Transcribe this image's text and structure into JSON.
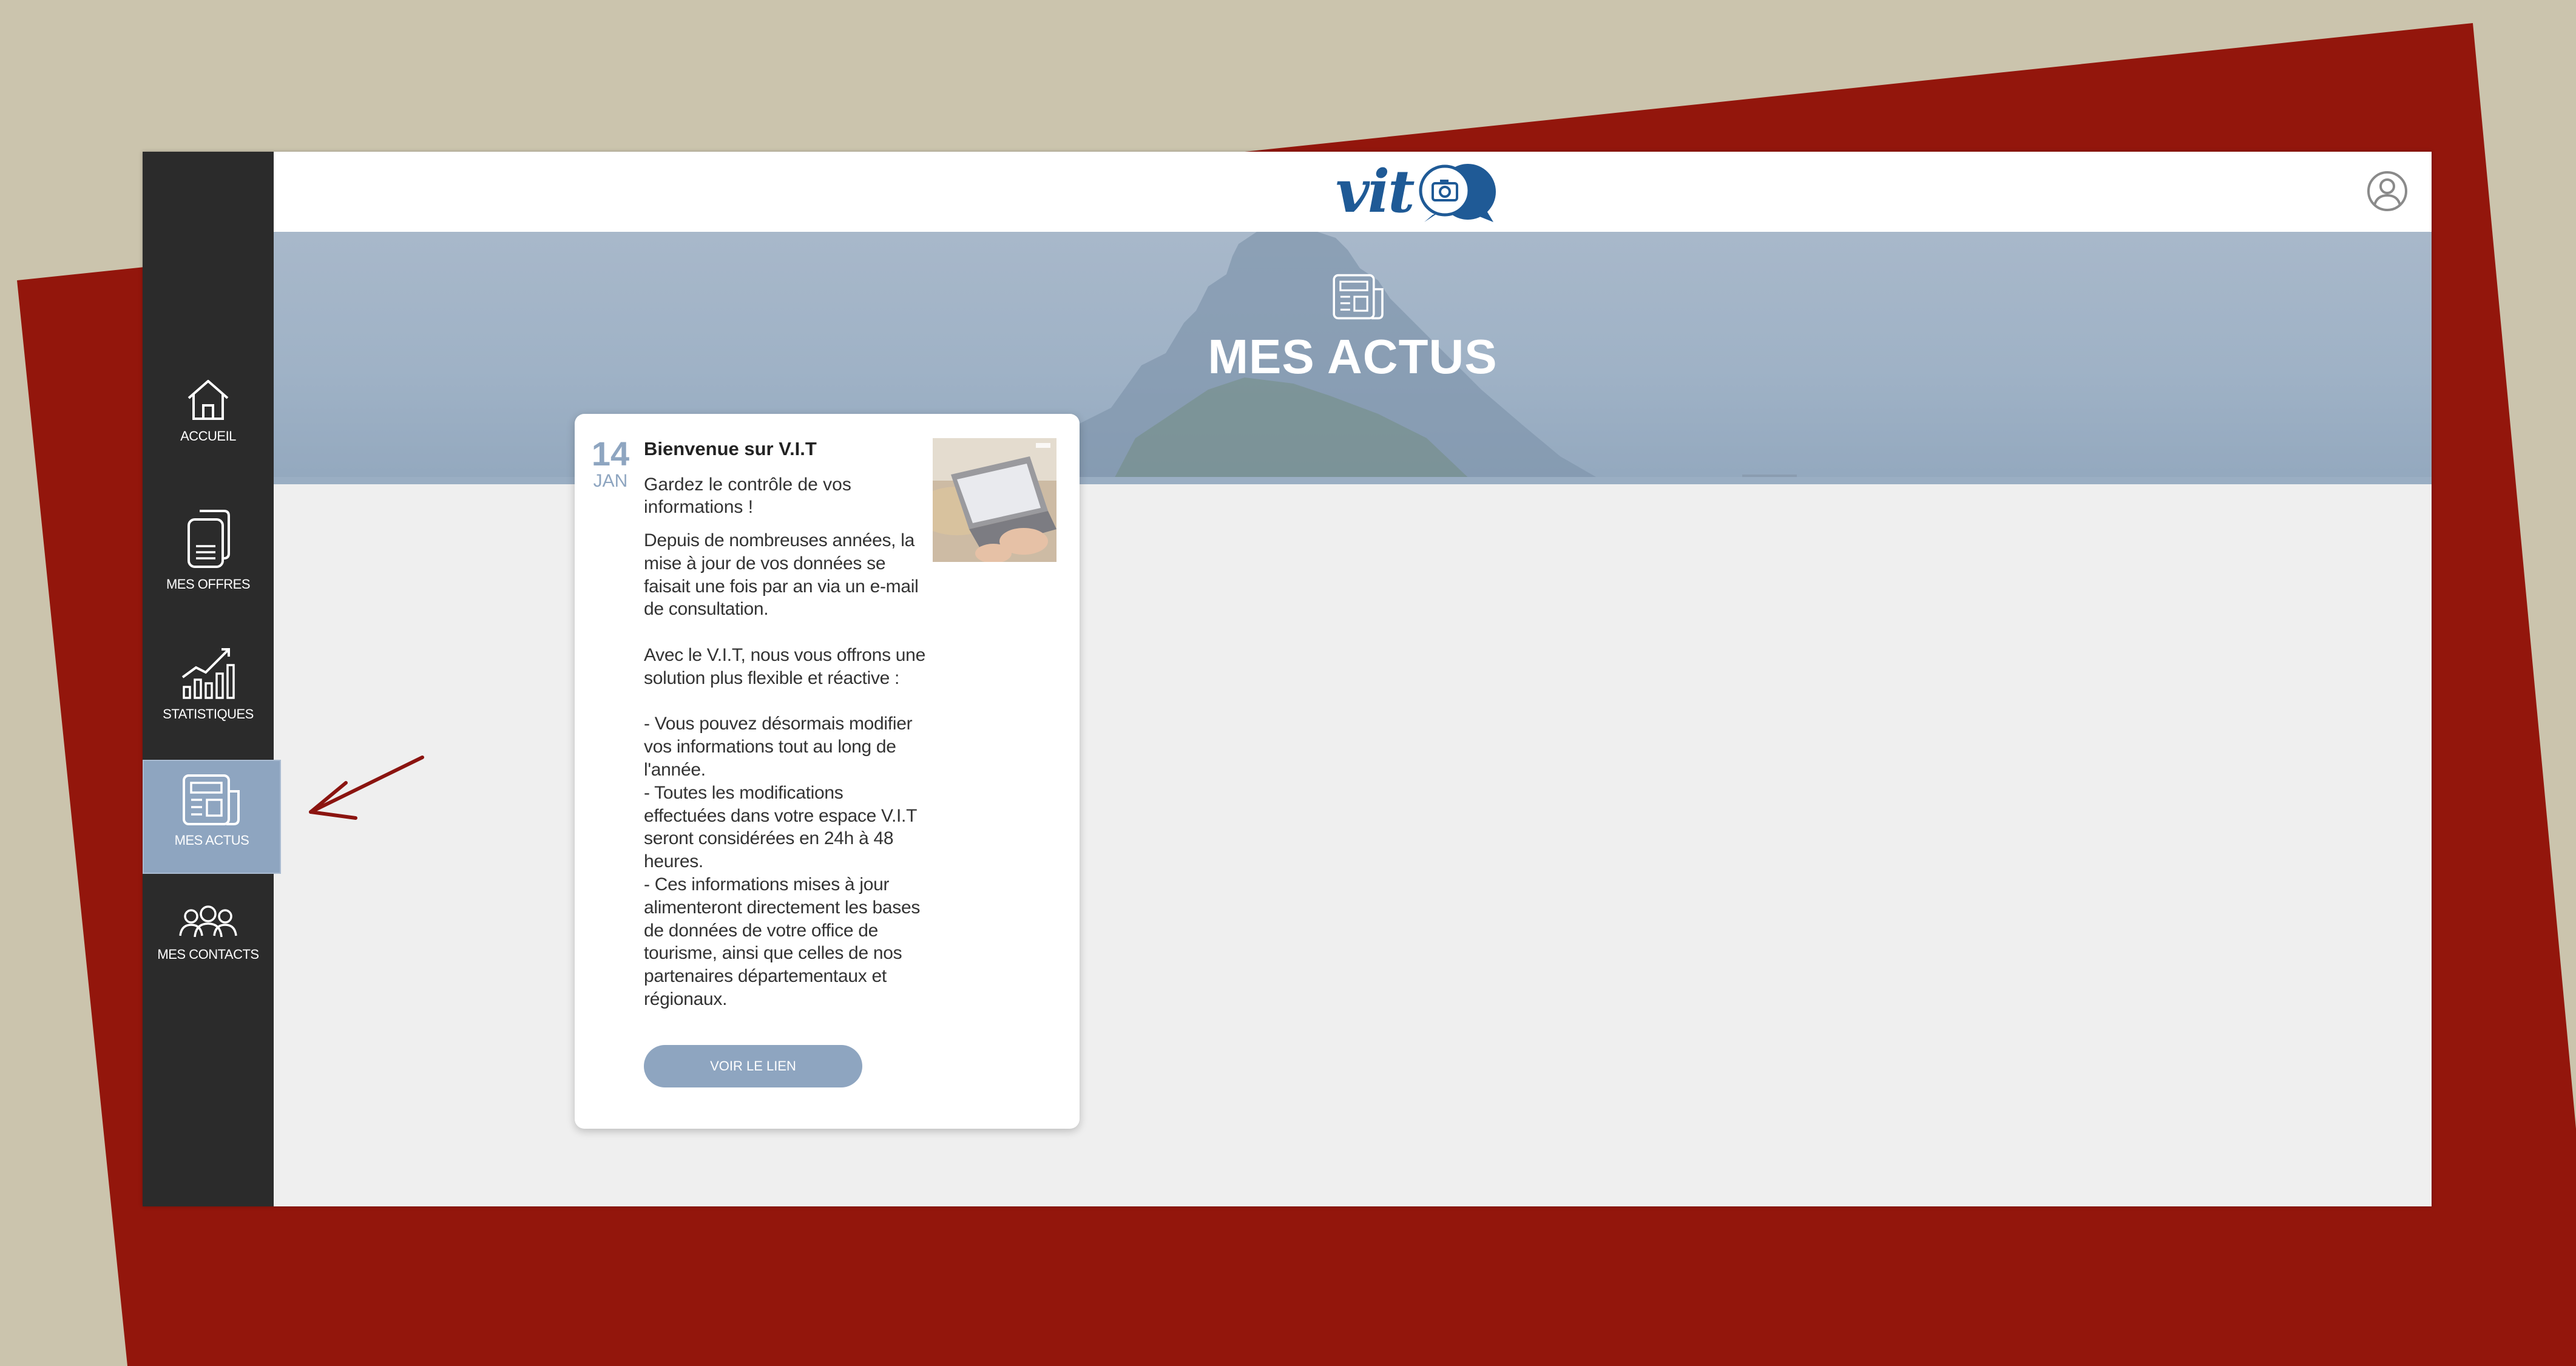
{
  "colors": {
    "background": "#cbc4ad",
    "frame_red": "#93160c",
    "sidebar": "#2b2b2b",
    "accent": "#8ea5c0",
    "brand": "#1f5a96",
    "annotation_arrow": "#8b1410"
  },
  "app": {
    "logo_text": "vit",
    "logo_icon": "camera-speech-bubble-icon",
    "user_icon": "user-circle-icon"
  },
  "sidebar": {
    "items": [
      {
        "label": "ACCUEIL",
        "icon": "home-icon",
        "active": false
      },
      {
        "label": "MES OFFRES",
        "icon": "documents-icon",
        "active": false
      },
      {
        "label": "STATISTIQUES",
        "icon": "bar-chart-icon",
        "active": false
      },
      {
        "label": "MES ACTUS",
        "icon": "newspaper-icon",
        "active": true
      },
      {
        "label": "MES CONTACTS",
        "icon": "contacts-icon",
        "active": false
      }
    ]
  },
  "hero": {
    "icon": "newspaper-icon",
    "title": "MES ACTUS"
  },
  "news": [
    {
      "day": "14",
      "month": "JAN",
      "title": "Bienvenue sur V.I.T",
      "subtitle": "Gardez le contrôle de vos informations !",
      "body": "Depuis de nombreuses années, la mise à jour de vos données se faisait une fois par an via un e-mail de consultation.\n\nAvec le V.I.T, nous vous offrons une solution plus flexible et réactive :\n\n- Vous pouvez désormais modifier vos informations tout au long de l'année.\n- Toutes les modifications effectuées dans votre espace V.I.T seront considérées en 24h à 48 heures.\n- Ces informations mises à jour alimenteront directement les bases de données de votre office de tourisme, ainsi que celles de nos partenaires départementaux et régionaux.",
      "link_label": "VOIR LE LIEN"
    }
  ]
}
